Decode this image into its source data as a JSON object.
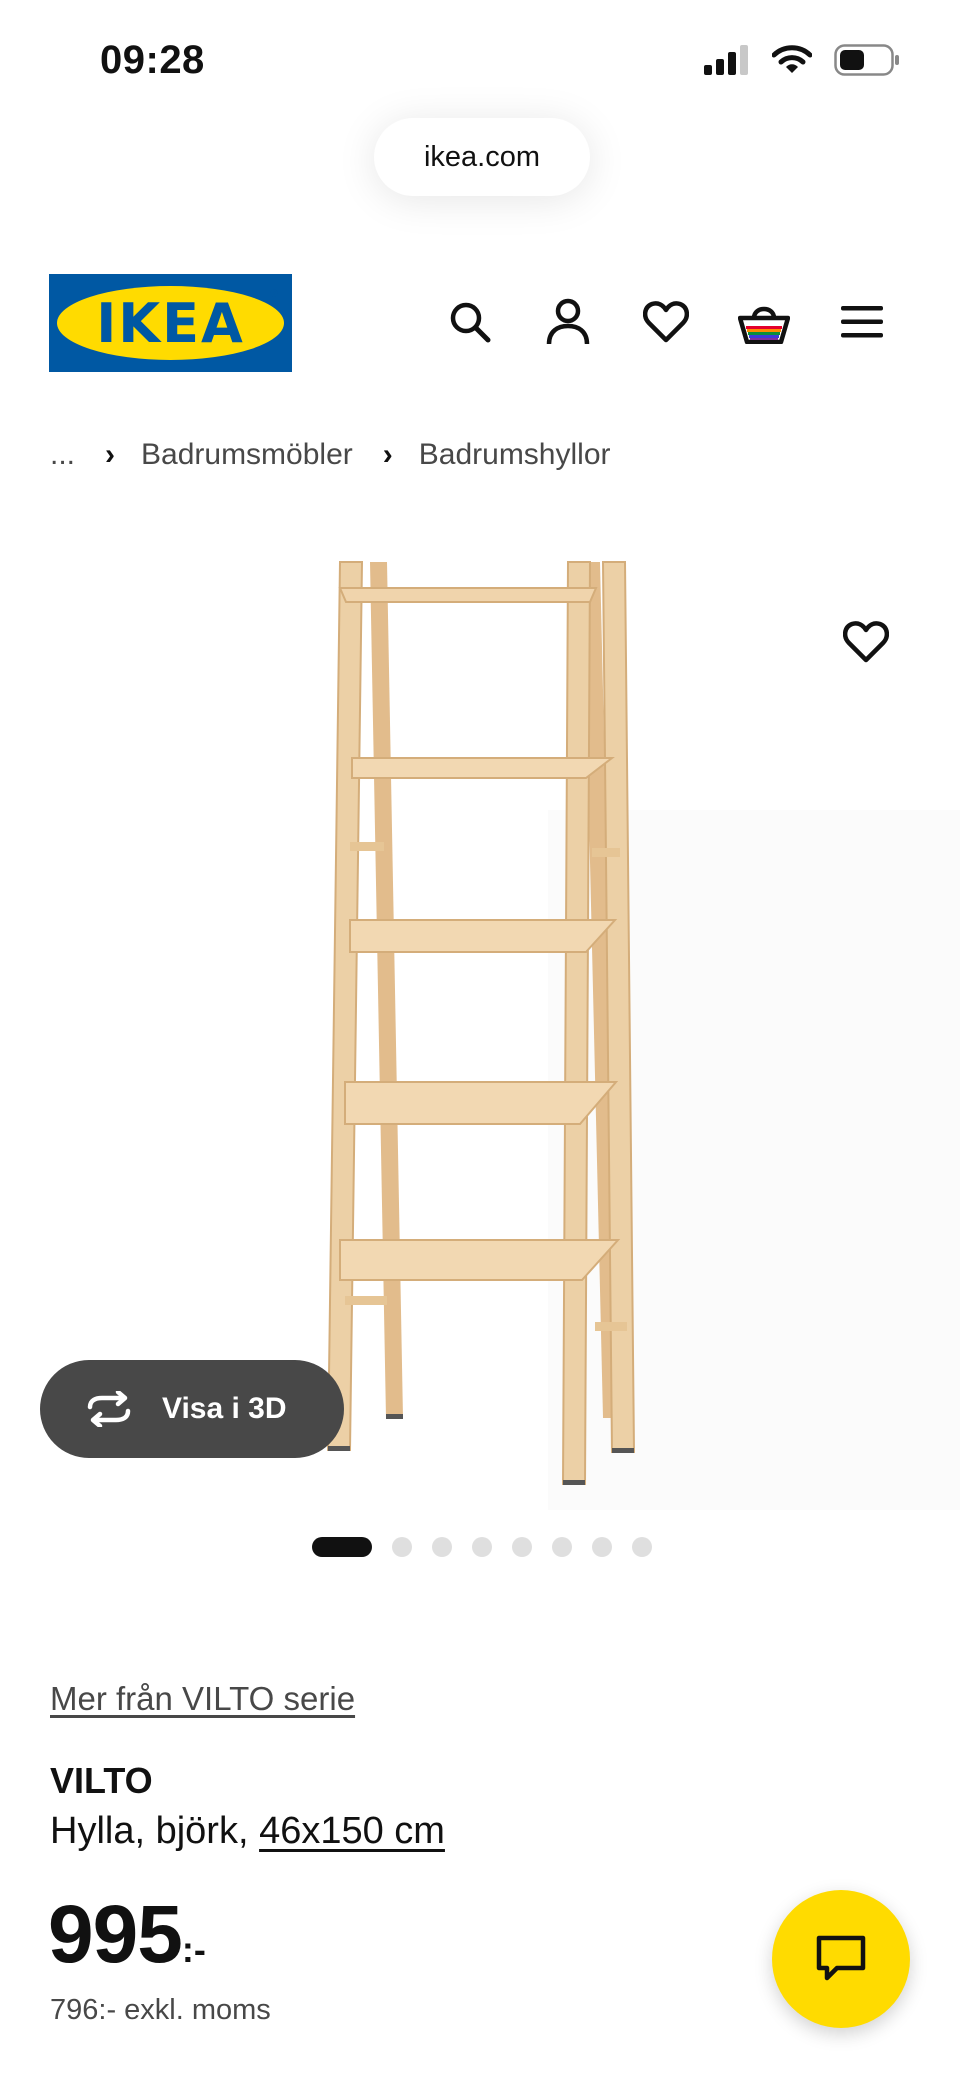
{
  "status_bar": {
    "time": "09:28"
  },
  "browser": {
    "url": "ikea.com"
  },
  "header": {
    "logo_text": "IKEA",
    "icons": [
      "search-icon",
      "account-icon",
      "favourites-icon",
      "basket-icon",
      "menu-icon"
    ]
  },
  "breadcrumb": {
    "ellipsis": "...",
    "items": [
      "Badrumsmöbler",
      "Badrumshyllor"
    ]
  },
  "gallery": {
    "view_3d_label": "Visa i 3D",
    "image_count": 8,
    "active_index": 0
  },
  "product": {
    "series_link": "Mer från VILTO serie",
    "name": "VILTO",
    "description": "Hylla, björk,",
    "size": "46x150 cm",
    "price": "995",
    "price_suffix": ":-",
    "price_excl_vat": "796:- exkl. moms"
  },
  "colors": {
    "ikea_blue": "#0058a3",
    "ikea_yellow": "#ffdb00",
    "wood": "#e9c79a"
  }
}
